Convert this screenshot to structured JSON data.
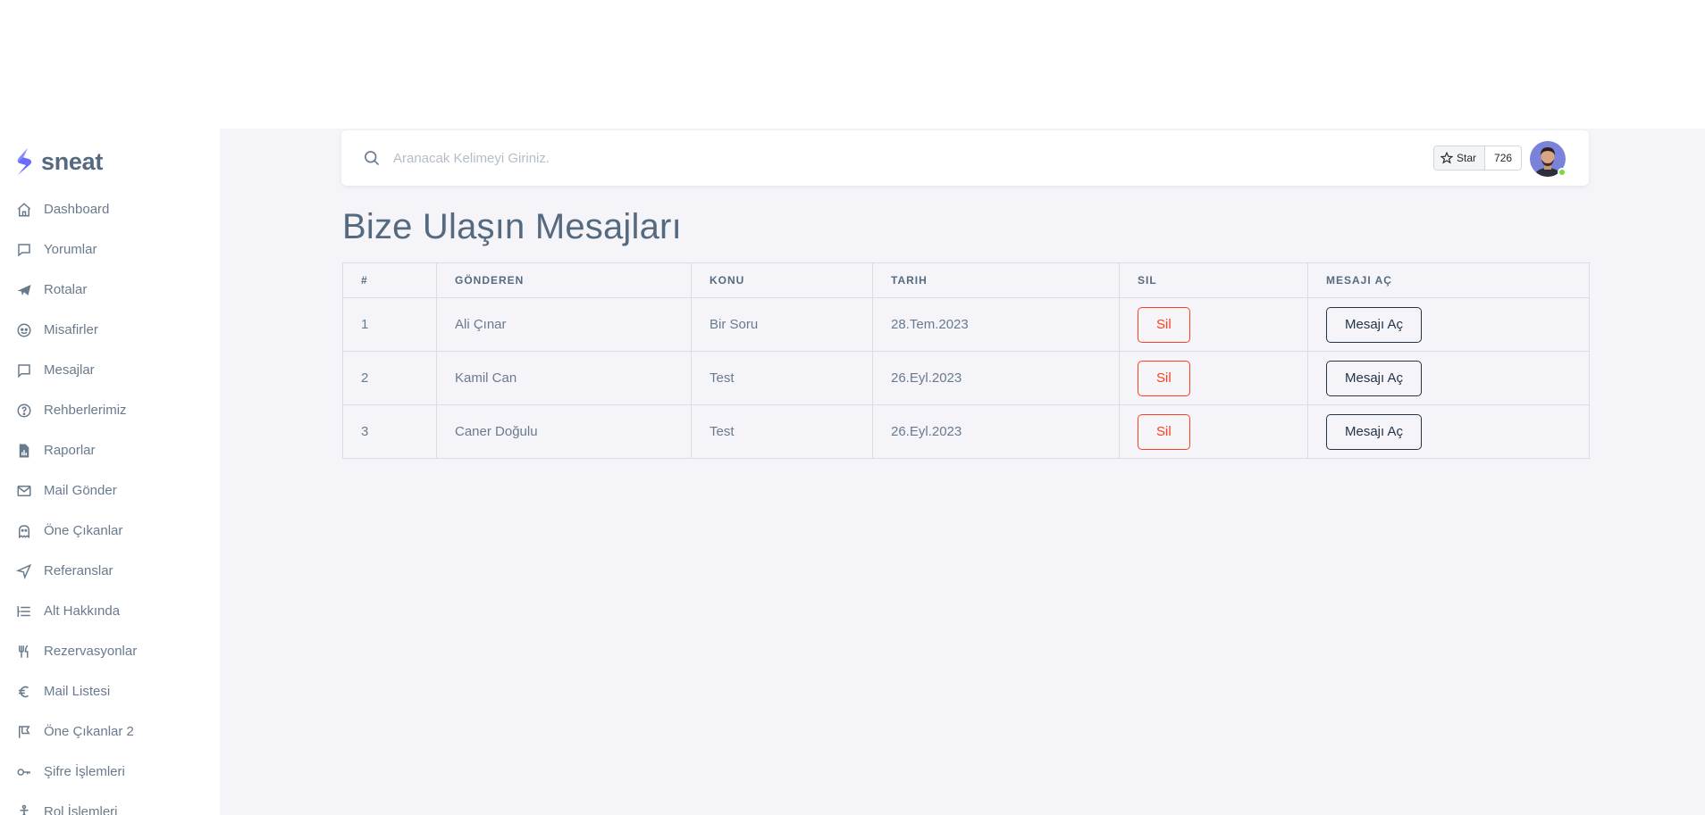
{
  "brand": {
    "name": "sneat"
  },
  "sidebar": {
    "items": [
      {
        "label": "Dashboard",
        "icon": "home-icon"
      },
      {
        "label": "Yorumlar",
        "icon": "comment-icon"
      },
      {
        "label": "Rotalar",
        "icon": "plane-icon"
      },
      {
        "label": "Misafirler",
        "icon": "face-icon"
      },
      {
        "label": "Mesajlar",
        "icon": "message-icon"
      },
      {
        "label": "Rehberlerimiz",
        "icon": "help-circle-icon"
      },
      {
        "label": "Raporlar",
        "icon": "report-file-icon"
      },
      {
        "label": "Mail Gönder",
        "icon": "mail-send-icon"
      },
      {
        "label": "Öne Çıkanlar",
        "icon": "ghost-icon"
      },
      {
        "label": "Referanslar",
        "icon": "send-icon"
      },
      {
        "label": "Alt Hakkında",
        "icon": "list-icon"
      },
      {
        "label": "Rezervasyonlar",
        "icon": "restaurant-icon"
      },
      {
        "label": "Mail Listesi",
        "icon": "euro-icon"
      },
      {
        "label": "Öne Çıkanlar 2",
        "icon": "bookmark-flag-icon"
      },
      {
        "label": "Şifre İşlemleri",
        "icon": "key-icon"
      },
      {
        "label": "Rol İşlemleri",
        "icon": "accessibility-icon"
      }
    ]
  },
  "navbar": {
    "search_placeholder": "Aranacak Kelimeyi Giriniz.",
    "star_label": "Star",
    "star_count": "726"
  },
  "page": {
    "title": "Bize Ulaşın Mesajları"
  },
  "table": {
    "headers": [
      "#",
      "GÖNDEREN",
      "KONU",
      "TARIH",
      "SIL",
      "MESAJI AÇ"
    ],
    "rows": [
      {
        "id": "1",
        "sender": "Ali Çınar",
        "subject": "Bir Soru",
        "date": "28.Tem.2023",
        "delete_label": "Sil",
        "open_label": "Mesajı Aç"
      },
      {
        "id": "2",
        "sender": "Kamil Can",
        "subject": "Test",
        "date": "26.Eyl.2023",
        "delete_label": "Sil",
        "open_label": "Mesajı Aç"
      },
      {
        "id": "3",
        "sender": "Caner Doğulu",
        "subject": "Test",
        "date": "26.Eyl.2023",
        "delete_label": "Sil",
        "open_label": "Mesajı Aç"
      }
    ]
  },
  "colors": {
    "accent": "#696cff",
    "danger": "#ff3e1d",
    "dark": "#233446",
    "online": "#71dd37"
  }
}
